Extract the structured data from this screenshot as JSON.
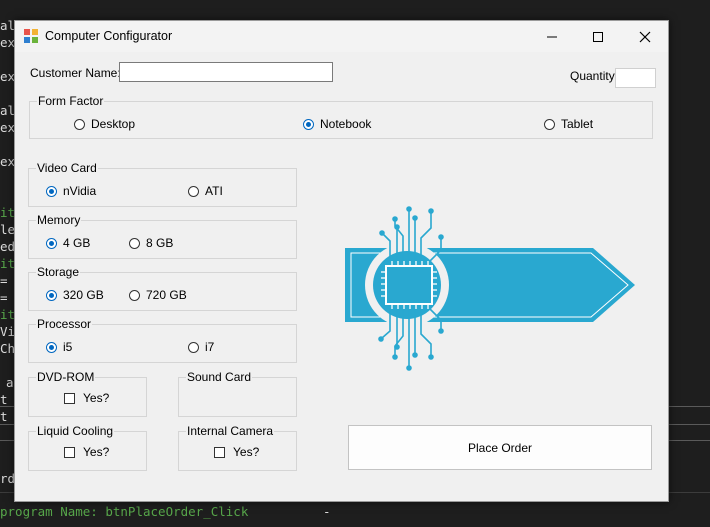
{
  "editor_bg": {
    "lines": [
      "al",
      "ex",
      "",
      "ex",
      "",
      "al",
      "ex",
      "",
      "ex",
      "",
      "it",
      "le",
      "ed",
      "it",
      "=",
      "=",
      "it",
      "Vi",
      "Ch"
    ],
    "lower_lines": [
      "a",
      "t",
      "t"
    ],
    "bottom_line": "program Name: btnPlaceOrder_Click",
    "bottom_marker": "-",
    "frd": "rd"
  },
  "window": {
    "title": "Computer Configurator",
    "icon": "app-icon",
    "minimize_icon": "minimize-icon",
    "maximize_icon": "maximize-icon",
    "close_icon": "close-icon"
  },
  "form": {
    "customer_name_label": "Customer Name:",
    "customer_name_value": "",
    "quantity_label": "Quantity:",
    "quantity_value": "",
    "form_factor": {
      "title": "Form Factor",
      "options": [
        "Desktop",
        "Notebook",
        "Tablet"
      ],
      "selected": "Notebook"
    },
    "video_card": {
      "title": "Video Card",
      "options": [
        "nVidia",
        "ATI"
      ],
      "selected": "nVidia"
    },
    "memory": {
      "title": "Memory",
      "options": [
        "4 GB",
        "8 GB"
      ],
      "selected": "4 GB"
    },
    "storage": {
      "title": "Storage",
      "options": [
        "320 GB",
        "720 GB"
      ],
      "selected": "320 GB"
    },
    "processor": {
      "title": "Processor",
      "options": [
        "i5",
        "i7"
      ],
      "selected": "i5"
    },
    "dvd_rom": {
      "title": "DVD-ROM",
      "check_label": "Yes?",
      "checked": false
    },
    "sound_card": {
      "title": "Sound Card"
    },
    "liquid_cooling": {
      "title": "Liquid Cooling",
      "check_label": "Yes?",
      "checked": false
    },
    "internal_camera": {
      "title": "Internal Camera",
      "check_label": "Yes?",
      "checked": false
    },
    "place_order_label": "Place Order"
  },
  "colors": {
    "accent": "#0067c0",
    "chip_blue": "#29a8d0"
  }
}
